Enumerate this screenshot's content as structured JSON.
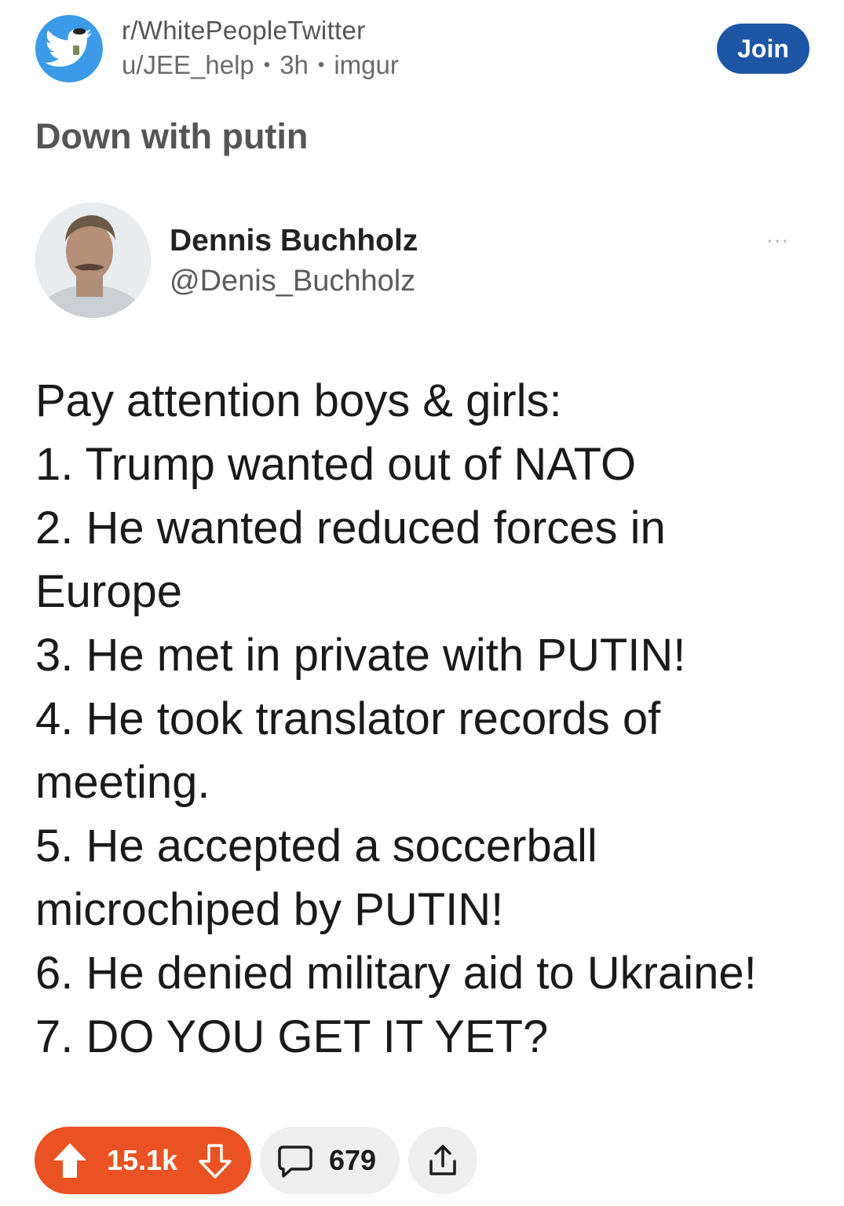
{
  "post": {
    "subreddit": "r/WhitePeopleTwitter",
    "author": "u/JEE_help",
    "age": "3h",
    "source": "imgur",
    "meta_separator": "•",
    "join_label": "Join",
    "title": "Down with putin"
  },
  "tweet": {
    "name": "Dennis Buchholz",
    "handle": "@Denis_Buchholz",
    "more": "···",
    "lines": [
      "Pay attention boys & girls:",
      "1. Trump wanted out of NATO",
      "2. He wanted reduced forces in",
      "Europe",
      "3. He met in private with PUTIN!",
      "4. He took translator records of",
      "meeting.",
      "5. He accepted a soccerball",
      "microchiped by PUTIN!",
      "6. He denied military aid to Ukraine!",
      "7. DO YOU GET IT YET?"
    ]
  },
  "actions": {
    "upvotes": "15.1k",
    "comments": "679"
  },
  "colors": {
    "vote_accent": "#ea5223",
    "join_button": "#1e56a6",
    "subreddit_icon": "#3b9be8"
  },
  "icons": {
    "subreddit": "twitter-bird-icon",
    "upvote": "upvote-arrow-icon",
    "downvote": "downvote-arrow-icon",
    "comment": "comment-bubble-icon",
    "share": "share-icon",
    "more": "more-dots-icon"
  }
}
